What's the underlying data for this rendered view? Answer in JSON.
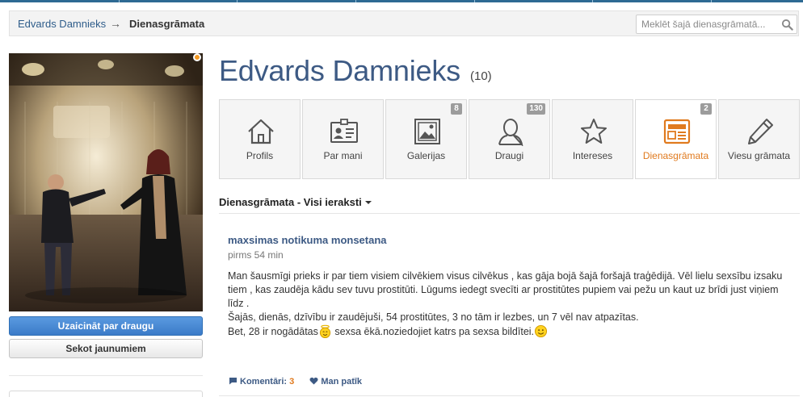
{
  "breadcrumb": {
    "user": "Edvards Damnieks",
    "separator": "→",
    "current": "Dienasgrāmata"
  },
  "search": {
    "placeholder": "Meklēt šajā dienasgrāmatā..."
  },
  "sidebar": {
    "invite_button": "Uzaicināt par draugu",
    "follow_button": "Sekot jaunumiem"
  },
  "profile": {
    "name": "Edvards Damnieks",
    "count": "(10)"
  },
  "tabs": [
    {
      "label": "Profils",
      "icon": "home-icon",
      "badge": ""
    },
    {
      "label": "Par mani",
      "icon": "id-card-icon",
      "badge": ""
    },
    {
      "label": "Galerijas",
      "icon": "picture-icon",
      "badge": "8"
    },
    {
      "label": "Draugi",
      "icon": "person-icon",
      "badge": "130"
    },
    {
      "label": "Intereses",
      "icon": "star-icon",
      "badge": ""
    },
    {
      "label": "Dienasgrāmata",
      "icon": "diary-icon",
      "badge": "2",
      "active": true
    },
    {
      "label": "Viesu grāmata",
      "icon": "pencil-icon",
      "badge": ""
    }
  ],
  "section": {
    "title": "Dienasgrāmata - Visi ieraksti"
  },
  "entry": {
    "title": "maxsimas notikuma monsetana",
    "time": "pirms 54 min",
    "p1": "Man šausmīgi prieks ir par tiem visiem cilvēkiem visus cilvēkus , kas gāja bojā šajā foršajā traģēdijā. Vēl lielu sexsību izsaku tiem , kas zaudēja kādu sev tuvu prostitūti. Lūgums iedegt svecīti ar prostitūtes pupiem vai pežu un kaut uz brīdi just viņiem līdz .",
    "p2": "Šajās,  dienās, dzīvību ir zaudējuši, 54 prostitūtes, 3 no tām ir lezbes, un 7 vēl nav atpazītas.",
    "p3_a": "Bet, 28 ir nogādātas",
    "p3_b": " sexsa ēkā.noziedojiet katrs pa sexsa bildītei.",
    "comments_label": "Komentāri: ",
    "comments_count": "3",
    "like_label": "Man patīk"
  },
  "colors": {
    "link_blue": "#3d5a84",
    "accent_orange": "#e07a1e",
    "primary_button": "#3b7bc8",
    "online_dot": "#f39a24"
  }
}
